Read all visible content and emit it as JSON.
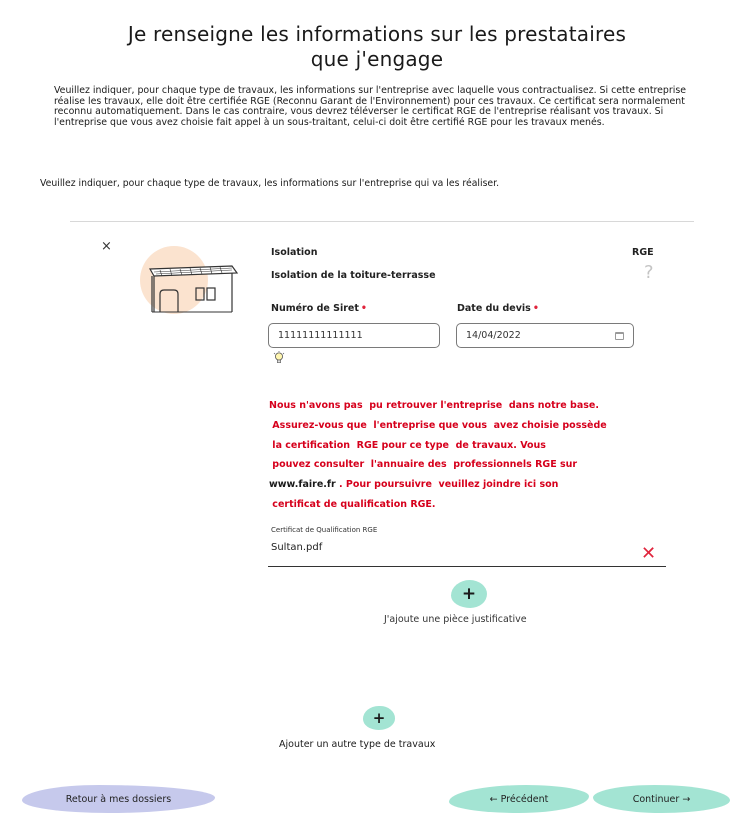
{
  "page": {
    "title_line1": "Je renseigne les informations sur les prestataires",
    "title_line2": "que j'engage",
    "intro": "Veuillez indiquer, pour chaque type de travaux, les informations sur l'entreprise avec laquelle vous contractualisez. Si cette entreprise réalise les travaux, elle doit être certifiée RGE (Reconnu Garant de l'Environnement) pour ces travaux. Ce certificat sera normalement reconnu automatiquement. Dans le cas contraire, vous devrez téléverser le certificat RGE de l'entreprise réalisant vos travaux. Si l'entreprise que vous avez choisie fait appel à un sous-traitant, celui-ci doit être certifié RGE pour les travaux menés.",
    "subtitle": "Veuillez indiquer, pour chaque type de travaux, les informations sur l'entreprise qui va les réaliser."
  },
  "work": {
    "close_symbol": "×",
    "type": "Isolation",
    "detail": "Isolation de la toiture-terrasse",
    "rge_label": "RGE",
    "rge_help": "?",
    "siret_label": "Numéro de Siret",
    "siret_value": "11111111111111",
    "date_label": "Date du devis",
    "date_value": "14/04/2022",
    "required_mark": "•"
  },
  "warning": {
    "line1": "Nous n'avons pas  pu retrouver l'entreprise  dans notre base.",
    "line2": " Assurez-vous que  l'entreprise que vous  avez choisie possède",
    "line3": " la certification  RGE pour ce type  de travaux. Vous",
    "line4": " pouvez consulter  l'annuaire des  professionnels RGE sur",
    "line5_link": "www.faire.fr",
    "line5_rest": " . Pour poursuivre  veuillez joindre ici son",
    "line6": " certificat de qualification RGE."
  },
  "certificate": {
    "label": "Certificat de Qualification RGE",
    "file_name": "Sultan.pdf",
    "remove_symbol": "✕"
  },
  "actions": {
    "plus_symbol": "+",
    "add_piece_label": "J'ajoute une pièce justificative",
    "add_work_label": "Ajouter un autre type de travaux"
  },
  "footer": {
    "back_label": "Retour à mes dossiers",
    "prev_label": "← Précédent",
    "next_label": "Continuer →"
  },
  "colors": {
    "accent_green": "#a3e4d3",
    "accent_lavender": "#c6c9ec",
    "error_red": "#d6001c"
  }
}
